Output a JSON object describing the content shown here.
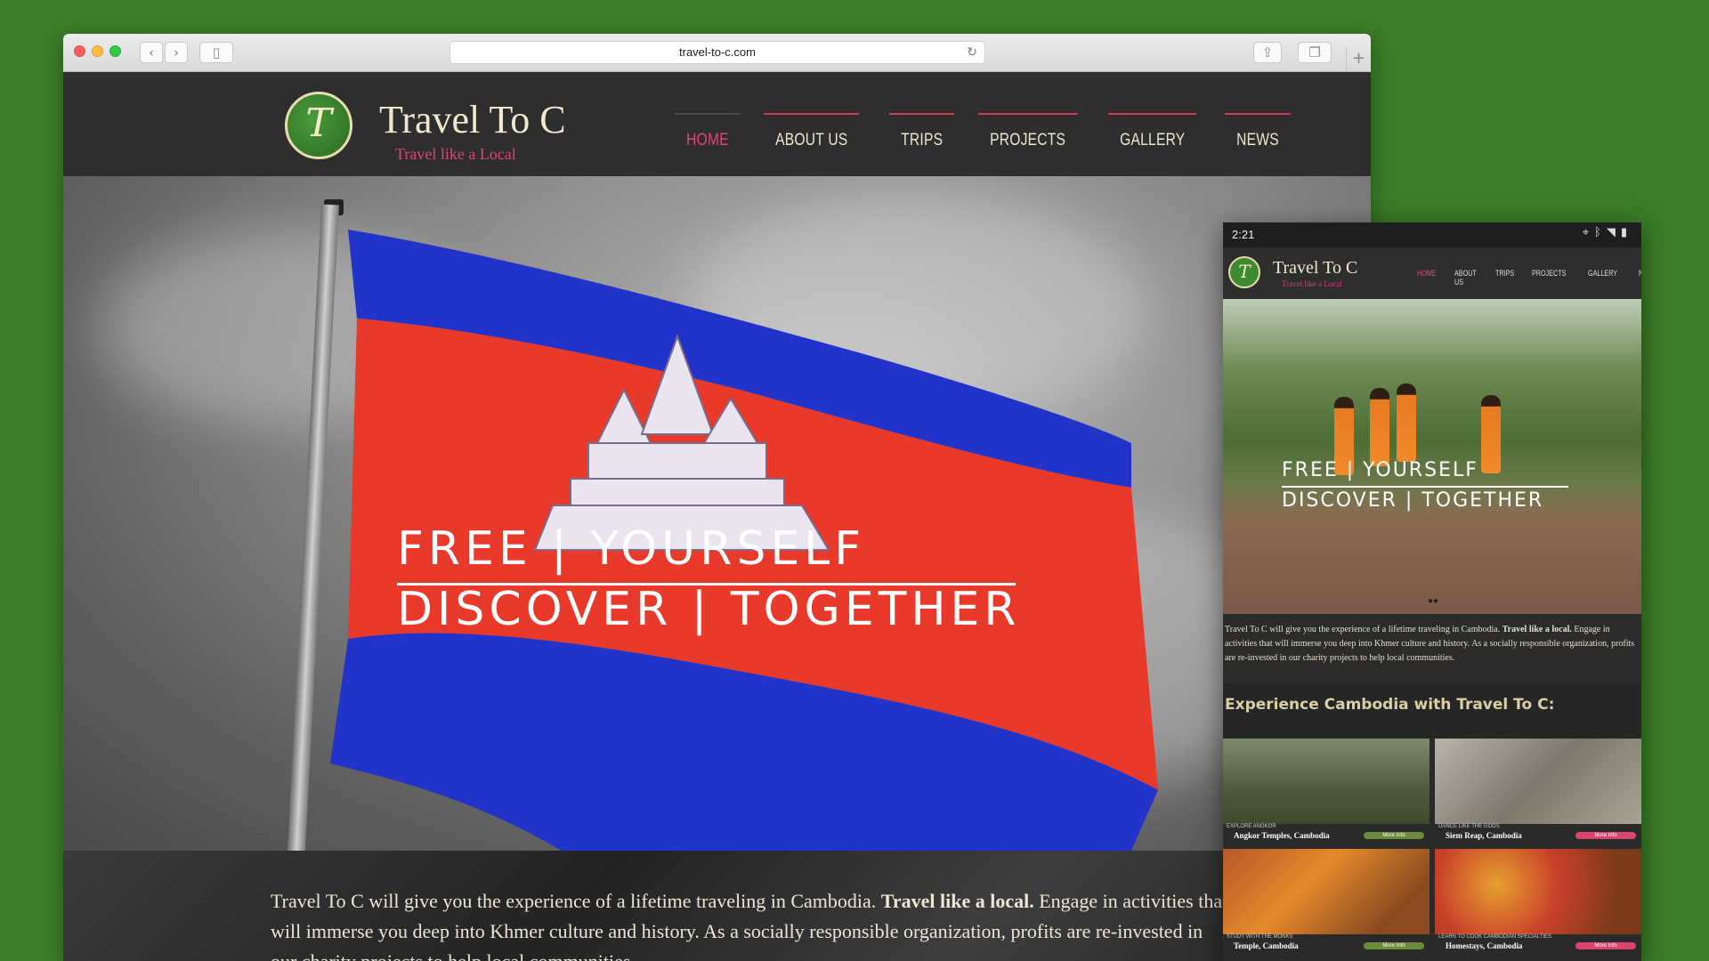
{
  "browser": {
    "url": "travel-to-c.com"
  },
  "site": {
    "brand_name": "Travel To C",
    "tagline": "Travel like a Local",
    "logo_letter": "T",
    "nav": [
      "HOME",
      "ABOUT US",
      "TRIPS",
      "PROJECTS",
      "GALLERY",
      "NEWS"
    ],
    "hero_line1": "FREE | YOURSELF",
    "hero_line2": "DISCOVER | TOGETHER",
    "about_text_start": "Travel To C will give you the experience of a lifetime traveling in  Cambodia. ",
    "about_bold": "Travel like a local.",
    "about_text_end": " Engage in activities that will immerse you deep into Khmer culture and history.  As a socially responsible organization, profits are re-invested in our charity projects to help local communities."
  },
  "mobile": {
    "time": "2:21",
    "about_text_start": "Travel To C will give you the experience of a lifetime traveling in  Cambodia. ",
    "about_bold": "Travel like a local.",
    "about_text_end": " Engage in activities that will immerse you deep into Khmer culture and history.  As a socially responsible organization, profits are re-invested in our charity projects to help local communities.",
    "experience_heading": "Experience Cambodia with Travel To C:",
    "cards": [
      {
        "small": "EXPLORE ANGKOR",
        "title": "Angkor Temples, Cambodia",
        "more": "More Info"
      },
      {
        "small": "DANCE LIKE THE GODS",
        "title": "Siem Reap, Cambodia",
        "more": "More Info"
      },
      {
        "small": "STUDY WITH THE MONKS",
        "title": "Temple, Cambodia",
        "more": "More Info"
      },
      {
        "small": "LEARN TO COOK CAMBODIAN SPECIALTIES",
        "title": "Homestays, Cambodia",
        "more": "More Info"
      }
    ]
  },
  "colors": {
    "background_green": "#3b7d28",
    "accent_pink": "#e0457a",
    "header_dark": "#2f2e2f",
    "flag_blue": "#2133c8",
    "flag_red": "#e8392a"
  },
  "icons": [
    "back-icon",
    "forward-icon",
    "sidebar-icon",
    "reload-icon",
    "share-icon",
    "tabs-icon",
    "new-tab-icon",
    "location-icon",
    "bluetooth-icon",
    "wifi-icon",
    "battery-icon"
  ]
}
